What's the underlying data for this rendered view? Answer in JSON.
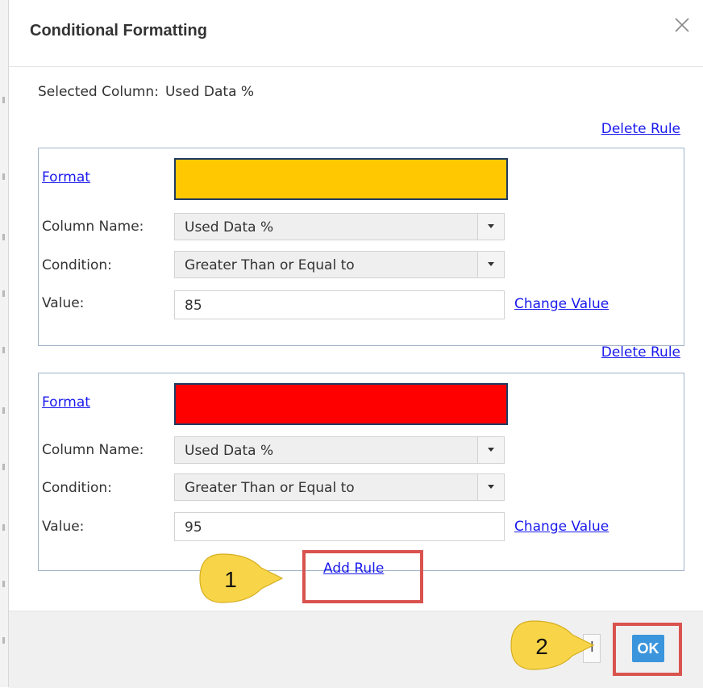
{
  "dialog": {
    "title": "Conditional Formatting",
    "selected_column_label": "Selected Column:",
    "selected_column_value": "Used Data %"
  },
  "labels": {
    "delete_rule": "Delete Rule",
    "format": "Format",
    "column_name": "Column Name:",
    "condition": "Condition:",
    "value": "Value:",
    "change_value": "Change Value",
    "add_rule": "Add Rule"
  },
  "rules": [
    {
      "color": "#ffc800",
      "column_name": "Used Data %",
      "condition": "Greater Than or Equal to",
      "value": "85"
    },
    {
      "color": "#ff0000",
      "column_name": "Used Data %",
      "condition": "Greater Than or Equal to",
      "value": "95"
    }
  ],
  "footer": {
    "ok_label": "OK"
  },
  "callouts": [
    {
      "number": "1"
    },
    {
      "number": "2"
    }
  ],
  "colors": {
    "accent_blue": "#3a95dd",
    "callout_yellow": "#f8d548",
    "highlight_red": "#d9534f"
  }
}
